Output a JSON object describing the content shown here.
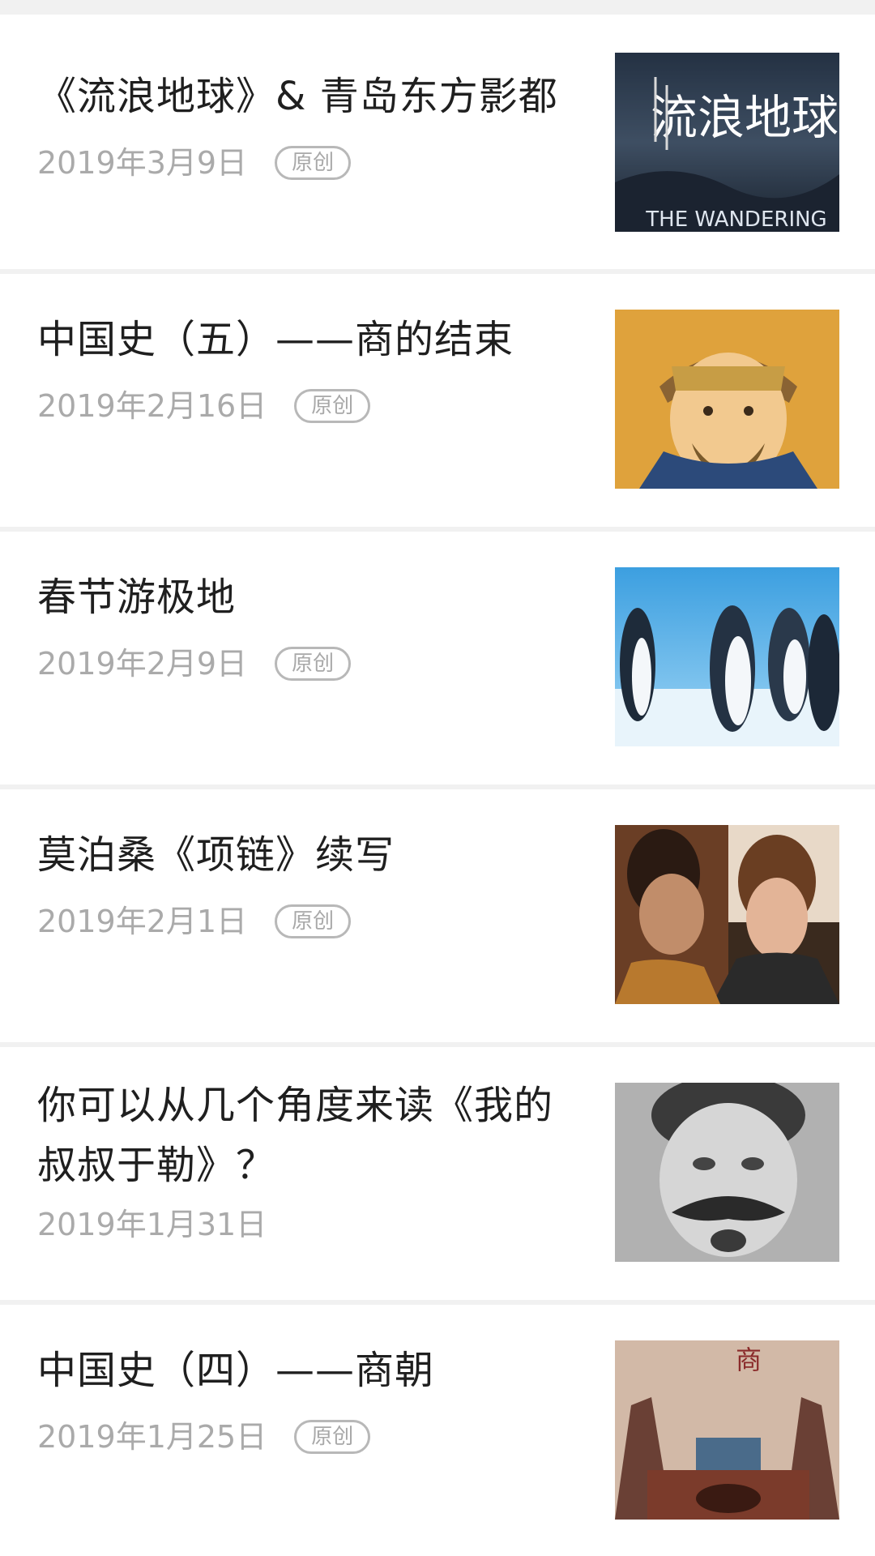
{
  "articles": [
    {
      "title": "《流浪地球》& 青岛东方影都",
      "date": "2019年3月9日",
      "badge": "原创",
      "thumb_icon": "wandering-earth-poster",
      "thumb_text": "流浪地球",
      "thumb_caption": "THE WANDERING"
    },
    {
      "title": "中国史（五）——商的结束",
      "date": "2019年2月16日",
      "badge": "原创",
      "thumb_icon": "ancient-king-portrait"
    },
    {
      "title": "春节游极地",
      "date": "2019年2月9日",
      "badge": "原创",
      "thumb_icon": "penguins-photo"
    },
    {
      "title": "莫泊桑《项链》续写",
      "date": "2019年2月1日",
      "badge": "原创",
      "thumb_icon": "film-still-two-women"
    },
    {
      "title": "你可以从几个角度来读《我的叔叔于勒》？",
      "date": "2019年1月31日",
      "thumb_icon": "bw-portrait-man"
    },
    {
      "title": "中国史（四）——商朝",
      "date": "2019年1月25日",
      "badge": "原创",
      "thumb_icon": "shang-dynasty-painting",
      "thumb_text": "商"
    }
  ]
}
